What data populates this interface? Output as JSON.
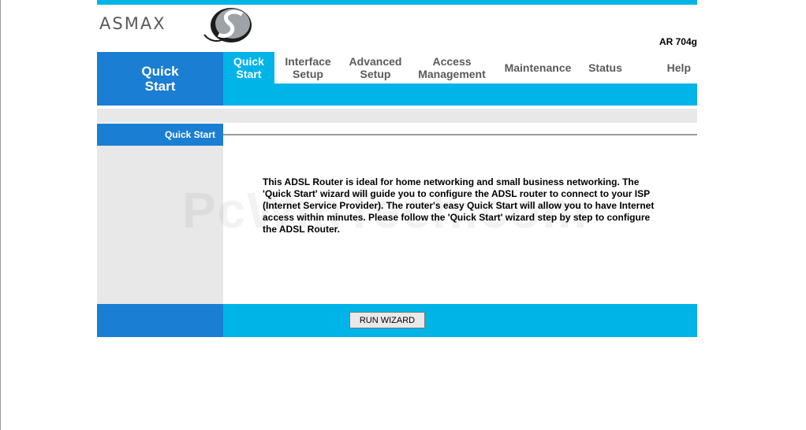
{
  "brand": {
    "logo_text": "ASMAX",
    "model": "AR 704g"
  },
  "nav": {
    "section_title_line1": "Quick",
    "section_title_line2": "Start",
    "tabs": [
      {
        "line1": "Quick",
        "line2": "Start",
        "active": true
      },
      {
        "line1": "Interface",
        "line2": "Setup",
        "active": false
      },
      {
        "line1": "Advanced",
        "line2": "Setup",
        "active": false
      },
      {
        "line1": "Access",
        "line2": "Management",
        "active": false
      },
      {
        "line1": "Maintenance",
        "line2": "",
        "active": false
      },
      {
        "line1": "Status",
        "line2": "",
        "active": false
      },
      {
        "line1": "Help",
        "line2": "",
        "active": false
      }
    ]
  },
  "content": {
    "section_label": "Quick Start",
    "description": "This ADSL Router is ideal for home networking and small business networking. The 'Quick Start' wizard will guide you to configure the ADSL router to connect to your ISP (Internet Service Provider). The router's easy Quick Start will allow you to have Internet access within minutes. Please follow the 'Quick Start' wizard step by step to configure the ADSL Router.",
    "run_wizard_label": "RUN WIZARD",
    "watermark": "PcWinTech.com"
  },
  "colors": {
    "accent_cyan": "#00b4e8",
    "accent_blue": "#1a7ed3",
    "panel_grey": "#e8e8e8"
  }
}
